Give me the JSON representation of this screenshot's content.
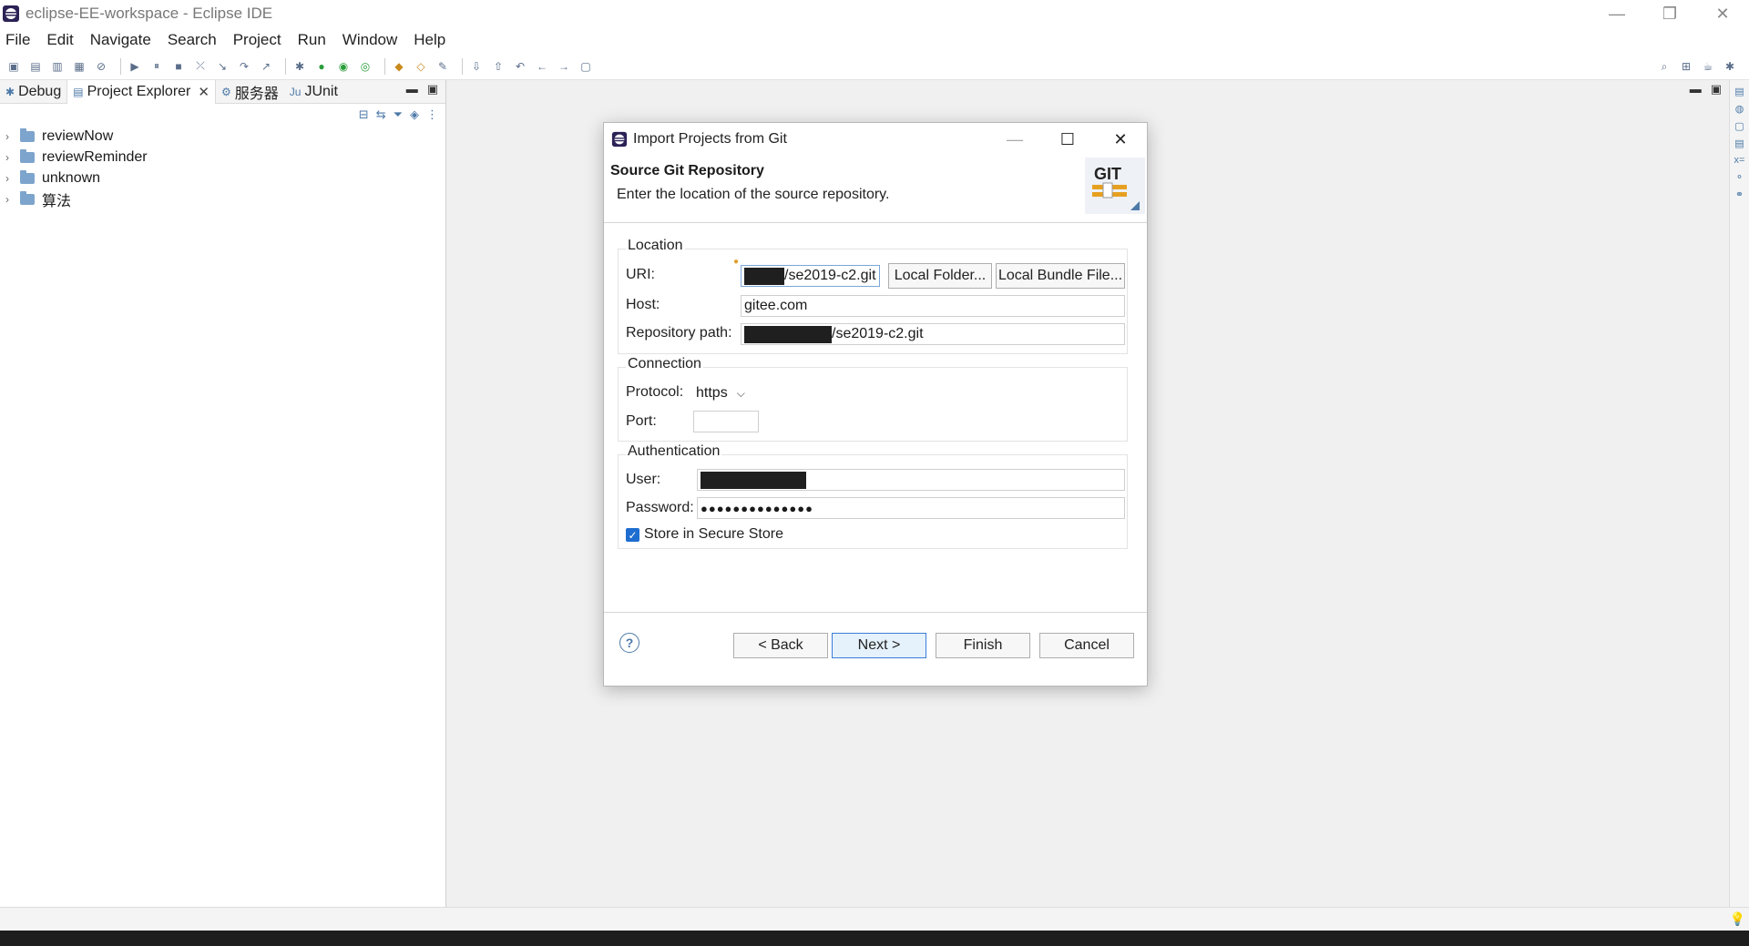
{
  "window": {
    "title": "eclipse-EE-workspace - Eclipse IDE",
    "controls": {
      "minimize": "—",
      "restore": "❐",
      "close": "✕"
    }
  },
  "menu": [
    "File",
    "Edit",
    "Navigate",
    "Search",
    "Project",
    "Run",
    "Window",
    "Help"
  ],
  "left_view": {
    "tabs": [
      {
        "label": "Debug",
        "icon": "debug-icon"
      },
      {
        "label": "Project Explorer",
        "icon": "project-explorer-icon",
        "active": true,
        "close": "✕"
      },
      {
        "label": "服务器",
        "icon": "servers-icon"
      },
      {
        "label": "JUnit",
        "icon": "junit-icon"
      }
    ],
    "projects": [
      {
        "name": "reviewNow"
      },
      {
        "name": "reviewReminder"
      },
      {
        "name": "unknown"
      },
      {
        "name": "算法"
      }
    ]
  },
  "dialog": {
    "title": "Import Projects from Git",
    "controls": {
      "minimize": "—",
      "maximize": "☐",
      "close": "✕"
    },
    "heading": "Source Git Repository",
    "description": "Enter the location of the source repository.",
    "logo_text": "GIT",
    "location": {
      "group_label": "Location",
      "uri_label": "URI:",
      "uri_value": "/se2019-c2.git",
      "local_folder_button": "Local Folder...",
      "local_bundle_button": "Local Bundle File...",
      "host_label": "Host:",
      "host_value": "gitee.com",
      "repo_path_label": "Repository path:",
      "repo_path_value": "/se2019-c2.git"
    },
    "connection": {
      "group_label": "Connection",
      "protocol_label": "Protocol:",
      "protocol_value": "https",
      "port_label": "Port:",
      "port_value": ""
    },
    "authentication": {
      "group_label": "Authentication",
      "user_label": "User:",
      "password_label": "Password:",
      "password_value": "●●●●●●●●●●●●●●",
      "store_label": "Store in Secure Store",
      "store_checked": true
    },
    "buttons": {
      "help": "?",
      "back": "< Back",
      "next": "Next >",
      "finish": "Finish",
      "cancel": "Cancel"
    }
  },
  "colors": {
    "accent": "#1e6dd0",
    "default_button_border": "#3b7dd8"
  }
}
